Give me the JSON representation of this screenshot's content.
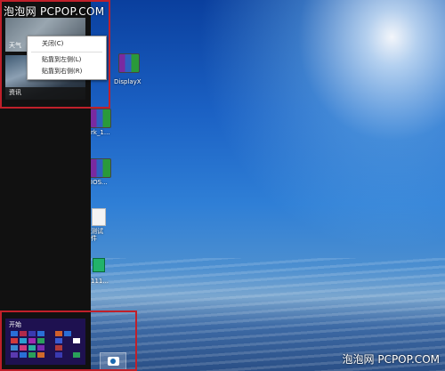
{
  "watermark": {
    "top": "泡泡网 PCPOP.COM",
    "bottom": "泡泡网 PCPOP.COM"
  },
  "switcher": {
    "apps": [
      {
        "label": "天气"
      },
      {
        "label": "资讯"
      }
    ]
  },
  "context_menu": {
    "items": [
      "关闭(C)",
      "贴靠到左侧(L)",
      "贴靠到右侧(R)"
    ]
  },
  "desktop": {
    "icons": [
      {
        "label": "DisplayX",
        "icon": "winrar-archive-icon"
      },
      {
        "label": "rk_1...",
        "icon": "winrar-archive-icon"
      },
      {
        "label": "IOS...",
        "icon": "winrar-archive-icon"
      },
      {
        "label": "测试\n件",
        "icon": "document-icon"
      },
      {
        "label": "111...",
        "icon": "app-icon"
      }
    ]
  },
  "start": {
    "label": "开始"
  },
  "colors": {
    "highlight": "#c0202a",
    "start_bg": "#1e1150"
  }
}
